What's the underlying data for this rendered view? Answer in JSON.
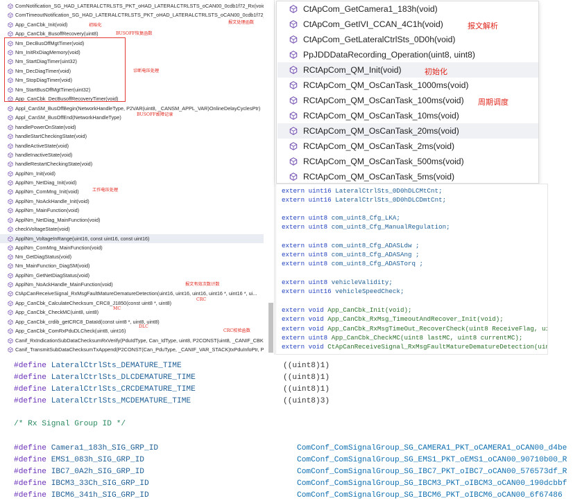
{
  "left_list": {
    "items": [
      "ComNotification_SG_HAD_LATERALCTRLSTS_PKT_oHAD_LATERALCTRLSTS_oCAN00_0cdb1f72_Rx(void)",
      "ComTimeoutNotification_SG_HAD_LATERALCTRLSTS_PKT_oHAD_LATERALCTRLSTS_oCAN00_0cdb1f72_Rx(...",
      "App_CanCbk_Init(void)",
      "App_CanCbk_BusoffRecovery(uint8)",
      "Nm_DecBusOffMgtTimer(void)",
      "Nm_InitRxDiagMemory(void)",
      "Nm_StartDiagTimer(uint32)",
      "Nm_DecDiagTimer(void)",
      "Nm_StopDiagTimer(void)",
      "Nm_StartBusOffMgtTimer(uint32)",
      "App_CanCbk_DecBusoffRecoveryTimer(void)",
      "Appl_CanSM_BusOffBegin(NetworkHandleType, P2VAR(uint8, _CANSM_APPL_VAR)OnlineDelayCyclesPtr)",
      "Appl_CanSM_BusOffEnd(NetworkHandleType)",
      "handlePowerOnState(void)",
      "handleStartCheckingState(void)",
      "handleActiveState(void)",
      "handleInactiveState(void)",
      "handleRestartCheckingState(void)",
      "ApplNm_Init(void)",
      "ApplNm_NetDiag_Init(void)",
      "ApplNm_ComMng_Init(void)",
      "ApplNm_NoAckHandle_Init(void)",
      "ApplNm_MainFunction(void)",
      "ApplNm_NetDiag_MainFunction(void)",
      "checkVoltageState(void)",
      "ApplNm_VoltageInRange(uint16, const uint16, const uint16)",
      "ApplNm_ComMng_MainFunction(void)",
      "Nm_GetDiagStatus(void)",
      "Nm_MainFunction_DiagSM(void)",
      "ApplNm_GetNetDiagStatus(void)",
      "ApplNm_NoAckHandle_MainFunction(void)",
      "CtApCanReceiveSignal_RxMsgFaultMatureDematureDetection(uint16, uint16, uint16, uint16 *, uint16 *, ui...",
      "App_CanCbk_CalculateChecksum_CRC8_J1850(const uint8 *, uint8)",
      "App_CanCbk_CheckMC(uint8, uint8)",
      "App_CanCbk_crdib_getCRC8_DataId(const uint8 *, uint8, uint8)",
      "App_CanCbk_ComRxPduDLCheck(uint8, uint16)",
      "Canif_RxIndicationSubDataChecksumRxVerify(PduIdType, Can_IdType, uint8, P2CONST(uint8, _CANIF_CBK...",
      "Canif_TransmitSubDataChecksumTxAppend(P2CONST(Can_PduType, _CANIF_VAR_STACK)txPduInfoPtr, P2V..."
    ],
    "annotations": {
      "init": "初始化",
      "rx_process": "报文处理函数",
      "busoff_recover": "BUSOFF恢复函数",
      "diag_voltage": "诊断电压处理",
      "busoff_record": "BUSOFF故障记录",
      "work_voltage": "工作电压处理",
      "msg_count": "报文有效次数计数",
      "crc": "CRC",
      "mc": "MC",
      "dlc": "DLC",
      "crc_algo": "CRC校验函数"
    }
  },
  "popup_list": {
    "items": [
      "CtApCom_GetCamera1_183h(void)",
      "CtApCom_GetIVI_CCAN_4C1h(void)",
      "CtApCom_GetLateralCtrlSts_0D0h(void)",
      "PpJDDDataRecording_Operation(uint8, uint8)",
      "RCtApCom_QM_Init(void)",
      "RCtApCom_QM_OsCanTask_1000ms(void)",
      "RCtApCom_QM_OsCanTask_100ms(void)",
      "RCtApCom_QM_OsCanTask_10ms(void)",
      "RCtApCom_QM_OsCanTask_20ms(void)",
      "RCtApCom_QM_OsCanTask_2ms(void)",
      "RCtApCom_QM_OsCanTask_500ms(void)",
      "RCtApCom_QM_OsCanTask_5ms(void)"
    ],
    "annotations": {
      "parse": "报文解析",
      "init": "初始化",
      "period": "周期调度"
    }
  },
  "code_right": {
    "lines": [
      {
        "kw": "extern",
        "type": "uint16",
        "rest": "LateralCtrlSts_0D0hDLCMtCnt;"
      },
      {
        "kw": "extern",
        "type": "uint16",
        "rest": "LateralCtrlSts_0D0hDLCDmtCnt;"
      },
      {
        "kw": "extern",
        "type": "uint8",
        "rest": "com_uint8_Cfg_LKA;"
      },
      {
        "kw": "extern",
        "type": "uint8",
        "rest": "com_uint8_Cfg_ManualRegulation;"
      },
      {
        "kw": "extern",
        "type": "uint8",
        "rest": "com_uint8_Cfg_ADASLdw ;"
      },
      {
        "kw": "extern",
        "type": "uint8",
        "rest": "com_uint8_Cfg_ADASAng ;"
      },
      {
        "kw": "extern",
        "type": "uint8",
        "rest": "com_uint8_Cfg_ADASTorq ;"
      },
      {
        "kw": "extern",
        "type": "uint8",
        "rest": "vehicleValidity;"
      },
      {
        "kw": "extern",
        "type": "uint16",
        "rest": "vehicleSpeedCheck;"
      },
      {
        "kw": "extern",
        "type": "void",
        "rest": "App_CanCbk_Init(void);"
      },
      {
        "kw": "extern",
        "type": "void",
        "rest": "App_CanCbk_RxMsg_TimeoutAndRecover_Init(void);"
      },
      {
        "kw": "extern",
        "type": "void",
        "rest": "App_CanCbk_RxMsgTimeOut_RecoverCheck(uint8 ReceiveFlag, uint"
      },
      {
        "kw": "extern",
        "type": "uint8",
        "rest": "App_CanCbk_CheckMC(uint8 lastMC, uint8 currentMC);"
      },
      {
        "kw": "extern",
        "type": "void",
        "rest": "CtApCanReceiveSignal_RxMsgFaultMatureDematureDetection(uint"
      }
    ]
  },
  "code_bottom": {
    "defines": [
      {
        "kw": "#define",
        "name": "LateralCtrlSts_DEMATURE_TIME",
        "value": "((uint8)1)"
      },
      {
        "kw": "#define",
        "name": "LateralCtrlSts_DLCDEMATURE_TIME",
        "value": "((uint8)1)"
      },
      {
        "kw": "#define",
        "name": "LateralCtrlSts_CRCDEMATURE_TIME",
        "value": "((uint8)1)"
      },
      {
        "kw": "#define",
        "name": "LateralCtrlSts_MCDEMATURE_TIME",
        "value": "((uint8)3)"
      }
    ],
    "comment": "/* Rx Signal Group ID */",
    "group_defines": [
      {
        "kw": "#define",
        "name": "Camera1_183h_SIG_GRP_ID",
        "value": "ComConf_ComSignalGroup_SG_CAMERA1_PKT_oCAMERA1_oCAN00_d4be"
      },
      {
        "kw": "#define",
        "name": "EMS1_083h_SIG_GRP_ID",
        "value": "ComConf_ComSignalGroup_SG_EMS1_PKT_oEMS1_oCAN00_90710b00_R"
      },
      {
        "kw": "#define",
        "name": "IBC7_0A2h_SIG_GRP_ID",
        "value": "ComConf_ComSignalGroup_SG_IBC7_PKT_oIBC7_oCAN00_576573df_R"
      },
      {
        "kw": "#define",
        "name": "IBCM3_33Ch_SIG_GRP_ID",
        "value": "ComConf_ComSignalGroup_SG_IBCM3_PKT_oIBCM3_oCAN00_190dcbbf"
      },
      {
        "kw": "#define",
        "name": "IBCM6_341h_SIG_GRP_ID",
        "value": "ComConf_ComSignalGroup_SG_IBCM6_PKT_oIBCM6_oCAN00_6f67486"
      }
    ]
  }
}
